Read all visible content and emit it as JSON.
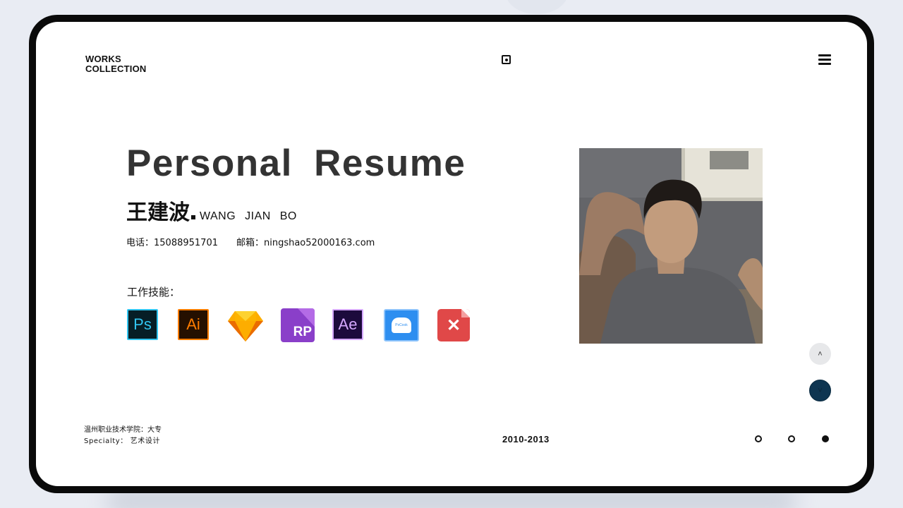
{
  "header": {
    "brand_line1": "WORKS",
    "brand_line2": "COLLECTION"
  },
  "hero": {
    "title": "Personal Resume",
    "name_cn": "王建波",
    "name_en": "WANG JIAN BO",
    "phone": "电话：15088951701",
    "email": "邮箱：ningshao52000163.com",
    "skills_label": "工作技能："
  },
  "skills": [
    {
      "label": "Ps",
      "icon": "photoshop-icon",
      "color": "#31c5f0"
    },
    {
      "label": "Ai",
      "icon": "illustrator-icon",
      "color": "#ff7c00"
    },
    {
      "label": "",
      "icon": "sketch-icon",
      "color": "#f7b500"
    },
    {
      "label": "RP",
      "icon": "axure-rp-icon",
      "color": "#8a3fc9"
    },
    {
      "label": "Ae",
      "icon": "after-effects-icon",
      "color": "#d5a8ff"
    },
    {
      "label": "PxCook",
      "icon": "pxcook-icon",
      "color": "#2d8ef0"
    },
    {
      "label": "✕",
      "icon": "xmind-icon",
      "color": "#e04848"
    }
  ],
  "footer": {
    "school": "温州职业技术学院：大专",
    "specialty": "Specialty： 艺术设计",
    "years": "2010-2013"
  },
  "nav": {
    "up_glyph": "˄",
    "down_glyph": "˅",
    "pagination_active_index": 2,
    "pagination_count": 3
  },
  "colors": {
    "background": "#e9ecf3",
    "frame": "#0a0a0a",
    "accent_dark": "#0e3551"
  }
}
